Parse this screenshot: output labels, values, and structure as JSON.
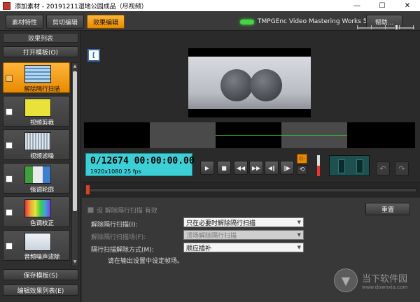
{
  "window": {
    "title": "添加素材 - 20191211湿地公园成品（尽视频）",
    "minimize": "—",
    "maximize": "☐",
    "close": "✕"
  },
  "toolbar": {
    "tabs": [
      "素材特性",
      "剪切编辑",
      "效果编辑"
    ],
    "active_tab": 2,
    "brand": "TMPGEnc Video Mastering Works 5",
    "help": "帮助..."
  },
  "left_panel": {
    "header": "效果列表",
    "open_template": "打开模板(O)",
    "filters": [
      {
        "label": "解除隔行扫描",
        "icon": "deinterlace-icon",
        "active": true
      },
      {
        "label": "视频剪裁",
        "icon": "scissors-icon",
        "active": false
      },
      {
        "label": "视频滤噪",
        "icon": "noise-filter-icon",
        "active": false
      },
      {
        "label": "强调轮廓",
        "icon": "sharpen-icon",
        "active": false
      },
      {
        "label": "色调校正",
        "icon": "color-correction-icon",
        "active": false
      },
      {
        "label": "音频噪声滤除",
        "icon": "audio-noise-icon",
        "active": false
      }
    ],
    "save_template": "保存模板(S)",
    "edit_list": "编辑效果列表(E)"
  },
  "player": {
    "timecode": "0/12674  00:00:00.00",
    "info": "1920x1080 25 fps",
    "buttons": [
      "▶",
      "■",
      "◀◀",
      "▶▶",
      "◀‖",
      "‖▶",
      "▶▶|"
    ]
  },
  "settings": {
    "enable_label": "设 解除隔行扫描 有效",
    "reset": "重置",
    "rows": [
      {
        "label": "解除隔行扫描(I):",
        "value": "只在必要时解除隔行扫描",
        "disabled": false
      },
      {
        "label": "解除隔行扫描场(F):",
        "value": "顶场解除隔行扫描",
        "disabled": true
      },
      {
        "label": "隔行扫描解除方式(M):",
        "value": "顺应插补",
        "disabled": false
      }
    ],
    "note": "请在输出设置中设定帧场。"
  },
  "watermark": {
    "cn": "当下软件园",
    "en": "www.downxia.com"
  },
  "colors": {
    "accent": "#f0a020",
    "timecode_bg": "#3ccfd6",
    "panel": "#383838"
  }
}
